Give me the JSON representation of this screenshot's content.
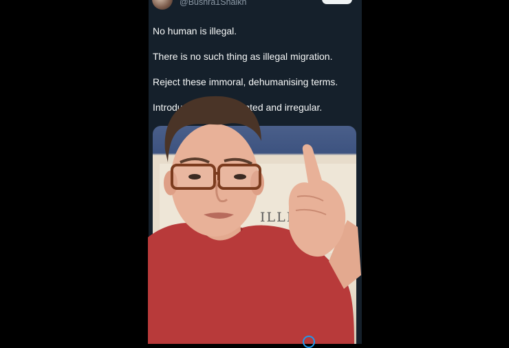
{
  "tweet": {
    "handle": "@Bushra1Shaikh",
    "lines": [
      "No human is illegal.",
      "There is no such thing as illegal migration.",
      "Reject these immoral, dehumanising terms.",
      "Introduce",
      "nted and irregular."
    ]
  },
  "media": {
    "sign_text": "ILLE"
  },
  "colors": {
    "background": "#15202b",
    "text": "#f7f9f9",
    "handle": "#8b98a5",
    "shirt": "#b83a3a"
  },
  "icons": [
    "avatar",
    "follow-pill",
    "link-icon"
  ]
}
